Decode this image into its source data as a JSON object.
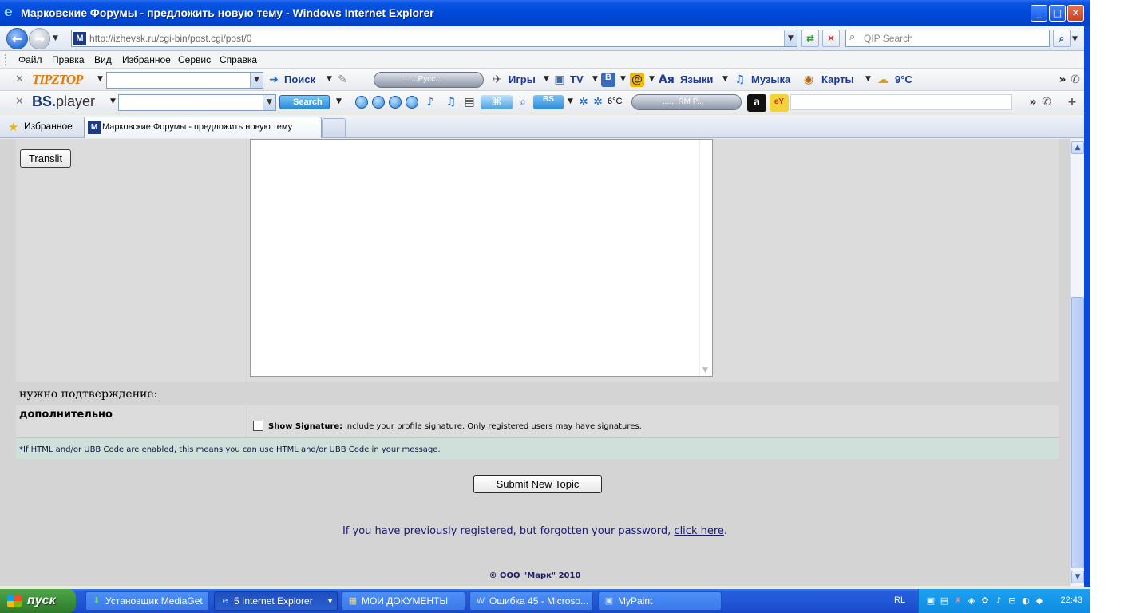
{
  "window": {
    "title": "Марковские Форумы - предложить новую тему - Windows Internet Explorer"
  },
  "address": {
    "url": "http://izhevsk.ru/cgi-bin/post.cgi/post/0",
    "search_placeholder": "QIP Search"
  },
  "menu": {
    "items": [
      "Файл",
      "Правка",
      "Вид",
      "Избранное",
      "Сервис",
      "Справка"
    ]
  },
  "toolbar1": {
    "logo": "TIPZTOP",
    "search": "Поиск",
    "radio": "......Русс...",
    "games": "Игры",
    "tv": "TV",
    "languages": "Языки",
    "music": "Музыка",
    "maps": "Карты",
    "weather": "9°C"
  },
  "toolbar2": {
    "logo_bs": "BS.",
    "logo_player": "player",
    "search": "Search",
    "weather": "6°C",
    "radio": "...... RM P..."
  },
  "tabs": {
    "favorites": "Избранное",
    "active_title": "Марковские Форумы - предложить новую тему"
  },
  "form": {
    "translit_button": "Translit",
    "confirm_label": "нужно подтверждение:",
    "extra_label": "дополнительно",
    "signature_label": "Show Signature:",
    "signature_desc": "include your profile signature. Only registered users may have signatures.",
    "note": "*If HTML and/or UBB Code are enabled, this means you can use HTML and/or UBB Code in your message.",
    "submit_button": "Submit New Topic",
    "forgot_text": "If you have previously registered, but forgotten your password,",
    "forgot_link": "click here",
    "forgot_end": ".",
    "copyright": "© ООО \"Марк\" 2010"
  },
  "taskbar": {
    "start": "пуск",
    "tasks": [
      "Установщик MediaGet",
      "5 Internet Explorer",
      "МОИ ДОКУМЕНТЫ",
      "Ошибка 45 - Microso...",
      "MyPaint"
    ],
    "lang": "RL",
    "clock": "22:43"
  },
  "colors": {
    "titlebar": "#0049d8",
    "taskbar": "#245edb",
    "page_bg": "#d4d4d4",
    "link": "#1a1a6a"
  }
}
